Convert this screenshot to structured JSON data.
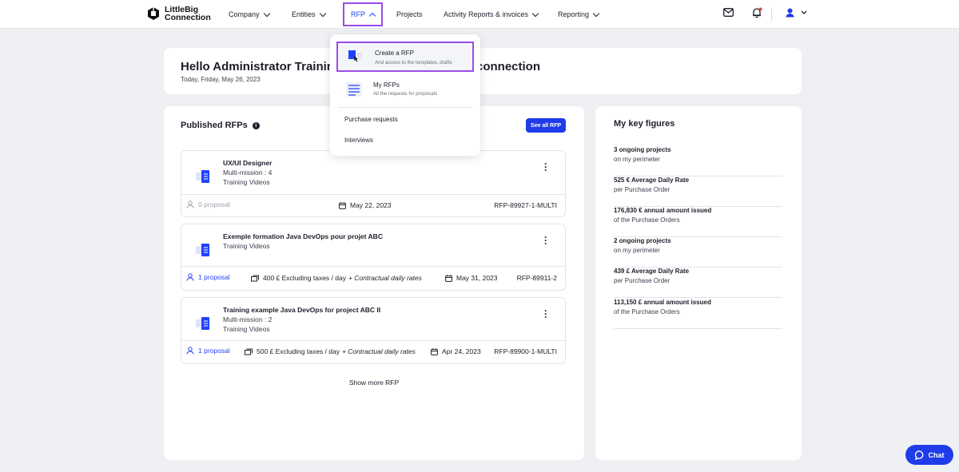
{
  "nav": {
    "logo_line1": "LittleBig",
    "logo_line2": "Connection",
    "items": [
      {
        "label": "Company"
      },
      {
        "label": "Entities"
      },
      {
        "label": "RFP"
      },
      {
        "label": "Projects"
      },
      {
        "label": "Activity Reports & invoices"
      },
      {
        "label": "Reporting"
      }
    ]
  },
  "welcome": {
    "title_left": "Hello Administrator Training V",
    "title_right": "connection",
    "date": "Today, Friday, May 26, 2023"
  },
  "rfp_panel": {
    "title": "Published RFPs",
    "see_all": "See all RFP",
    "show_more": "Show more RFP",
    "cards": [
      {
        "title": "UX/UI Designer",
        "line2": "Multi-mission : 4",
        "line3": "Training Videos",
        "proposal": "0 proposal",
        "date": "May 22, 2023",
        "ref": "RFP-89927-1-MULTI"
      },
      {
        "title": "Exemple formation Java DevOps pour projet ABC",
        "line2": "Training Videos",
        "proposal": "1 proposal",
        "rate": "400 £ Excluding taxes / day",
        "rate_note": "+ Contractual daily rates",
        "date": "May 31, 2023",
        "ref": "RFP-89911-2"
      },
      {
        "title": "Training example Java DevOps for project ABC II",
        "line2": "Multi-mission : 2",
        "line3": "Training Videos",
        "proposal": "1 proposal",
        "rate": "500 £ Excluding taxes / day",
        "rate_note": "+ Contractual daily rates",
        "date": "Apr 24, 2023",
        "ref": "RFP-89900-1-MULTI"
      }
    ]
  },
  "key_figures": {
    "title": "My key figures",
    "items": [
      {
        "value": "3 ongoing projects",
        "label": "on my perimeter"
      },
      {
        "value": "525 € Average Daily Rate",
        "label": "per Purchase Order"
      },
      {
        "value": "176,830 € annual amount issued",
        "label": "of the Purchase Orders"
      },
      {
        "value": "2 ongoing projects",
        "label": "on my perimeter"
      },
      {
        "value": "439 £ Average Daily Rate",
        "label": "per Purchase Order"
      },
      {
        "value": "113,150 £ annual amount issued",
        "label": "of the Purchase Orders"
      }
    ]
  },
  "dropdown": {
    "create_title": "Create a RFP",
    "create_sub": "And access to the templates, drafts",
    "my_title": "My RFPs",
    "my_sub": "All the requests for proposals",
    "purchase_requests": "Purchase requests",
    "interviews": "Interviews"
  },
  "chat": {
    "label": "Chat"
  },
  "colors": {
    "accent": "#1f3ce8",
    "highlight": "#9b4dea",
    "link": "#2142ff"
  }
}
